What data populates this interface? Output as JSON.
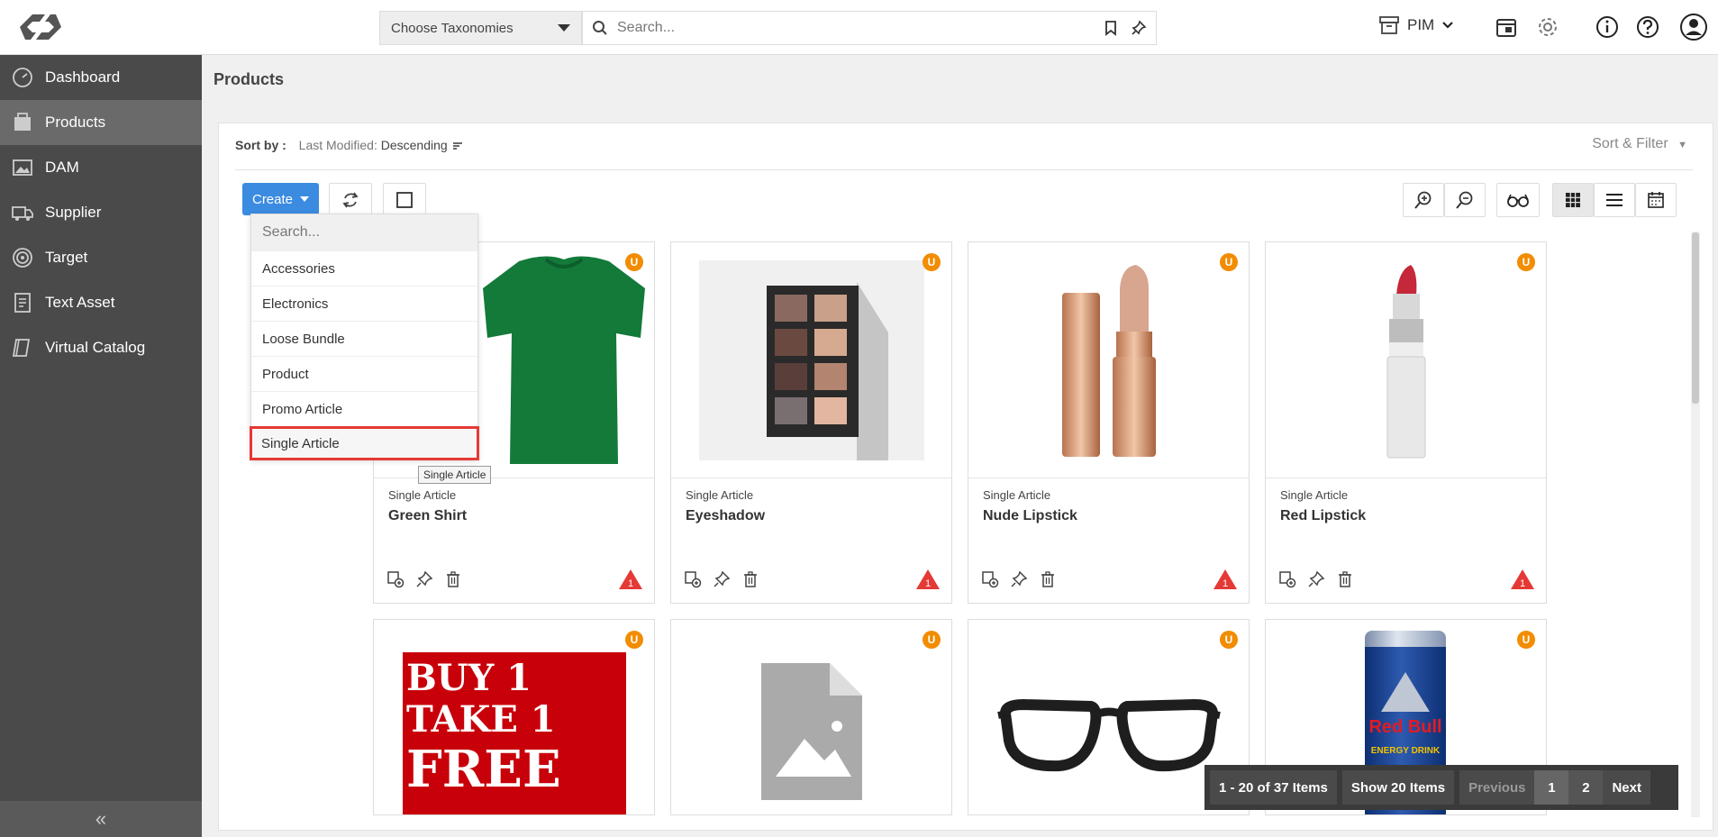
{
  "header": {
    "taxonomy_label": "Choose Taxonomies",
    "search_placeholder": "Search...",
    "module_label": "PIM"
  },
  "sidebar": {
    "items": [
      {
        "label": "Dashboard",
        "icon": "dashboard-icon"
      },
      {
        "label": "Products",
        "icon": "products-icon"
      },
      {
        "label": "DAM",
        "icon": "image-icon"
      },
      {
        "label": "Supplier",
        "icon": "truck-icon"
      },
      {
        "label": "Target",
        "icon": "target-icon"
      },
      {
        "label": "Text Asset",
        "icon": "document-icon"
      },
      {
        "label": "Virtual Catalog",
        "icon": "book-icon"
      }
    ],
    "active": "Products",
    "collapse_label": "«"
  },
  "page": {
    "title": "Products",
    "sort_by_label": "Sort by :",
    "sort_field": "Last Modified:",
    "sort_order": "Descending",
    "sort_filter_label": "Sort & Filter",
    "create_label": "Create"
  },
  "create_menu": {
    "search_placeholder": "Search...",
    "items": [
      "Accessories",
      "Electronics",
      "Loose Bundle",
      "Product",
      "Promo Article",
      "Single Article"
    ],
    "highlighted": "Single Article",
    "tooltip": "Single Article"
  },
  "products": [
    {
      "type": "Single Article",
      "name": "Green Shirt",
      "badge": "U",
      "warning": "1"
    },
    {
      "type": "Single Article",
      "name": "Eyeshadow",
      "badge": "U",
      "warning": "1"
    },
    {
      "type": "Single Article",
      "name": "Nude Lipstick",
      "badge": "U",
      "warning": "1"
    },
    {
      "type": "Single Article",
      "name": "Red Lipstick",
      "badge": "U",
      "warning": "1"
    },
    {
      "badge": "U",
      "promo_text": [
        "BUY 1",
        "TAKE 1",
        "FREE"
      ]
    },
    {
      "badge": "U"
    },
    {
      "badge": "U"
    },
    {
      "badge": "U",
      "can_brand": "Red Bull",
      "can_sub": "ENERGY DRINK"
    }
  ],
  "pagination": {
    "range": "1 - 20 of 37 Items",
    "page_size": "Show 20 Items",
    "previous": "Previous",
    "pages": [
      "1",
      "2"
    ],
    "next": "Next"
  },
  "colors": {
    "accent": "#3b8be0",
    "sidebar_bg": "#4a4a4a",
    "badge": "#f28c00",
    "warning": "#e53935",
    "highlight_border": "#e53935"
  }
}
